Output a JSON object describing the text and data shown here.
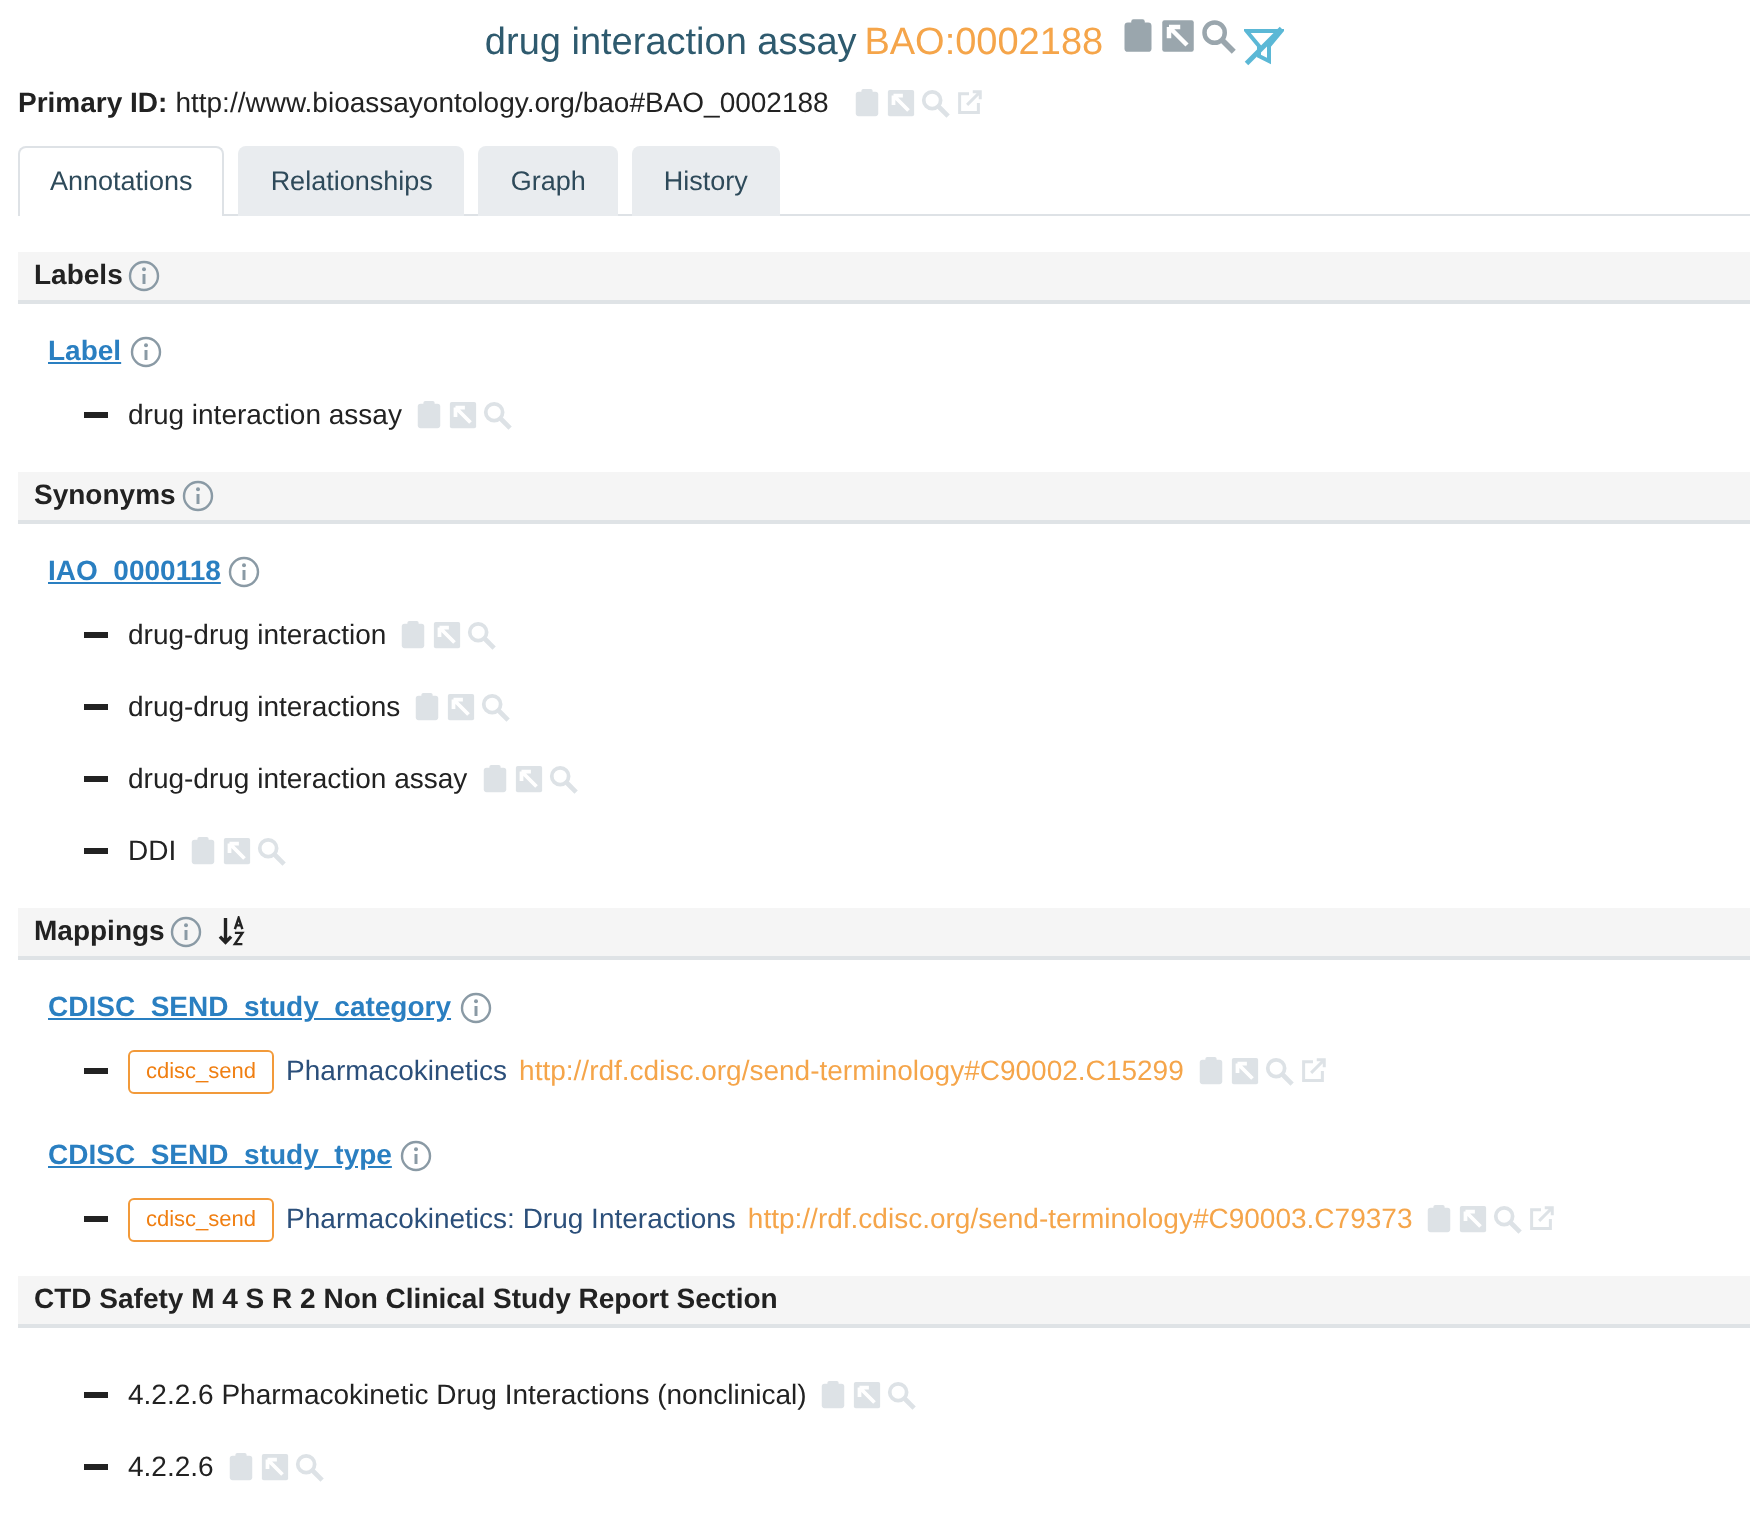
{
  "title": {
    "label": "drug interaction assay",
    "id": "BAO:0002188"
  },
  "primary_id": {
    "label": "Primary ID:",
    "value": "http://www.bioassayontology.org/bao#BAO_0002188"
  },
  "tabs": [
    {
      "label": "Annotations",
      "selected": true
    },
    {
      "label": "Relationships",
      "selected": false
    },
    {
      "label": "Graph",
      "selected": false
    },
    {
      "label": "History",
      "selected": false
    }
  ],
  "sections": [
    {
      "title": "Labels",
      "info": true,
      "sortable": false,
      "groups": [
        {
          "property": "Label",
          "values": [
            {
              "text": "drug interaction assay",
              "external_link": false
            }
          ]
        }
      ]
    },
    {
      "title": "Synonyms",
      "info": true,
      "sortable": false,
      "groups": [
        {
          "property": "IAO_0000118",
          "values": [
            {
              "text": "drug-drug interaction",
              "external_link": false
            },
            {
              "text": "drug-drug interactions",
              "external_link": false
            },
            {
              "text": "drug-drug interaction assay",
              "external_link": false
            },
            {
              "text": "DDI",
              "external_link": false
            }
          ]
        }
      ]
    },
    {
      "title": "Mappings",
      "info": true,
      "sortable": true,
      "groups": [
        {
          "property": "CDISC_SEND_study_category",
          "values": [
            {
              "tag": "cdisc_send",
              "text": "Pharmacokinetics",
              "url": "http://rdf.cdisc.org/send-terminology#C90002.C15299",
              "external_link": true
            }
          ]
        },
        {
          "property": "CDISC_SEND_study_type",
          "values": [
            {
              "tag": "cdisc_send",
              "text": "Pharmacokinetics: Drug Interactions",
              "url": "http://rdf.cdisc.org/send-terminology#C90003.C79373",
              "external_link": true
            }
          ]
        }
      ]
    },
    {
      "title": "CTD Safety M 4 S R 2 Non Clinical Study Report Section",
      "info": false,
      "sortable": false,
      "groups": [
        {
          "values": [
            {
              "text": "4.2.2.6 Pharmacokinetic Drug Interactions (nonclinical)",
              "external_link": false
            },
            {
              "text": "4.2.2.6",
              "external_link": false
            }
          ]
        }
      ]
    }
  ]
}
